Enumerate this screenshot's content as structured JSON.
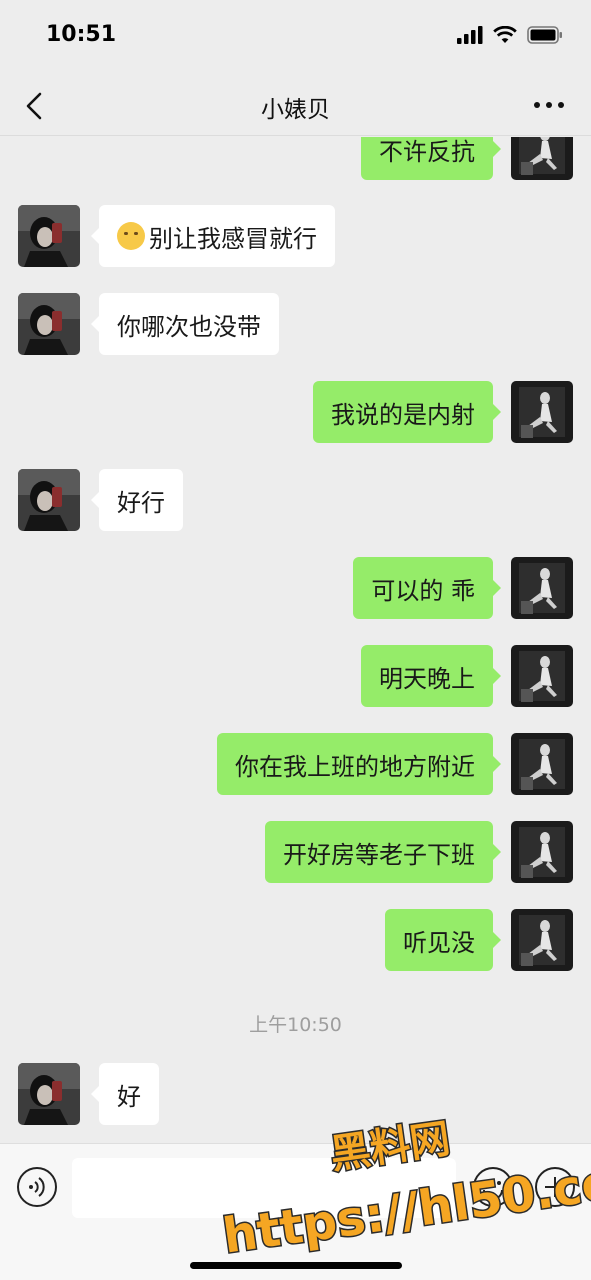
{
  "status_bar": {
    "time": "10:51"
  },
  "header": {
    "title": "小婊贝"
  },
  "messages": [
    {
      "side": "right",
      "text": "不许反抗"
    },
    {
      "side": "left",
      "text": "别让我感冒就行",
      "emoji": true
    },
    {
      "side": "left",
      "text": "你哪次也没带"
    },
    {
      "side": "right",
      "text": "我说的是内射"
    },
    {
      "side": "left",
      "text": "好行"
    },
    {
      "side": "right",
      "text": "可以的 乖"
    },
    {
      "side": "right",
      "text": "明天晚上"
    },
    {
      "side": "right",
      "text": "你在我上班的地方附近"
    },
    {
      "side": "right",
      "text": "开好房等老子下班"
    },
    {
      "side": "right",
      "text": "听见没"
    },
    {
      "side": "left",
      "text": "好"
    }
  ],
  "timestamp": "上午10:50",
  "watermark": {
    "line1": "黑料网",
    "line2": "https://hl50.co"
  },
  "colors": {
    "background": "#ededed",
    "bubble_sent": "#95ec69",
    "bubble_received": "#ffffff",
    "watermark": "#f5a623"
  },
  "icons": [
    "wifi-icon",
    "signal-icon",
    "battery-icon",
    "back-icon",
    "more-icon",
    "voice-icon",
    "emoji-icon",
    "plus-icon"
  ]
}
